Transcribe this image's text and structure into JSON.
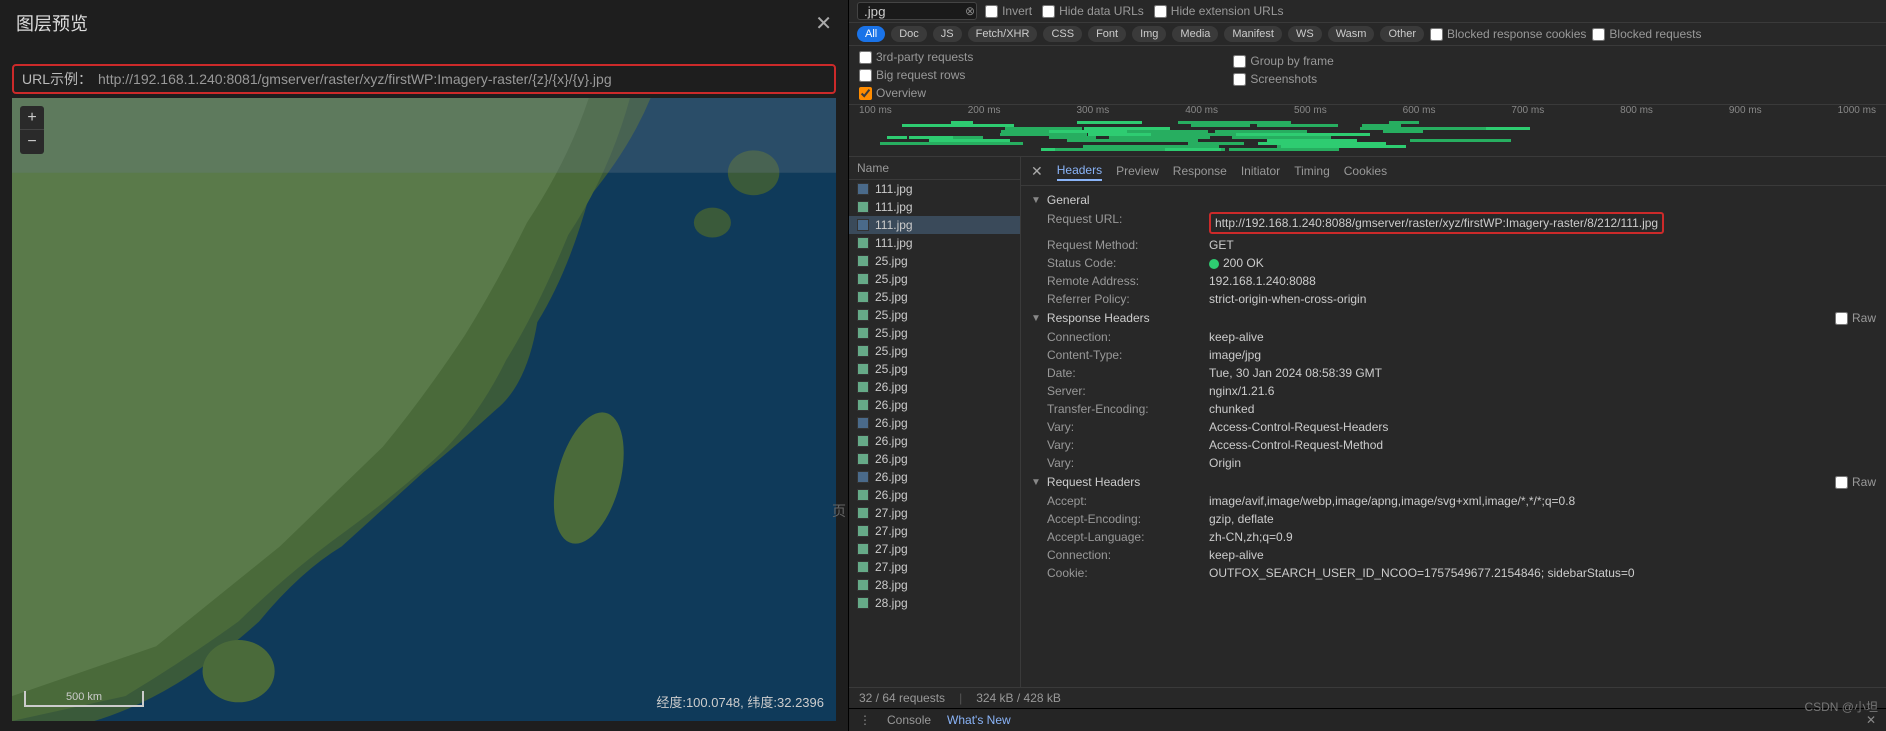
{
  "left": {
    "title": "图层预览",
    "url_label": "URL示例：",
    "url_value": "http://192.168.1.240:8081/gmserver/raster/xyz/firstWP:Imagery-raster/{z}/{x}/{y}.jpg",
    "scale": "500 km",
    "coords": "经度:100.0748, 纬度:32.2396",
    "page_glyph": "页",
    "watermark": "CSDN @小坦"
  },
  "devtools": {
    "filter_value": ".jpg",
    "checkboxes": {
      "invert": "Invert",
      "hide_data": "Hide data URLs",
      "hide_ext": "Hide extension URLs"
    },
    "types": [
      "All",
      "Doc",
      "JS",
      "Fetch/XHR",
      "CSS",
      "Font",
      "Img",
      "Media",
      "Manifest",
      "WS",
      "Wasm",
      "Other"
    ],
    "type_cb": {
      "blocked_cookies": "Blocked response cookies",
      "blocked_requests": "Blocked requests"
    },
    "opts": {
      "third_party": "3rd-party requests",
      "big_rows": "Big request rows",
      "overview": "Overview",
      "group_frame": "Group by frame",
      "screenshots": "Screenshots"
    },
    "timeline_ticks": [
      "100 ms",
      "200 ms",
      "300 ms",
      "400 ms",
      "500 ms",
      "600 ms",
      "700 ms",
      "800 ms",
      "900 ms",
      "1000 ms"
    ],
    "name_header": "Name",
    "requests": [
      {
        "name": "111.jpg",
        "sel": false,
        "c": "b"
      },
      {
        "name": "111.jpg",
        "sel": false,
        "c": "g"
      },
      {
        "name": "111.jpg",
        "sel": true,
        "c": "b"
      },
      {
        "name": "111.jpg",
        "sel": false,
        "c": "g"
      },
      {
        "name": "25.jpg",
        "sel": false,
        "c": "g"
      },
      {
        "name": "25.jpg",
        "sel": false,
        "c": "g"
      },
      {
        "name": "25.jpg",
        "sel": false,
        "c": "g"
      },
      {
        "name": "25.jpg",
        "sel": false,
        "c": "g"
      },
      {
        "name": "25.jpg",
        "sel": false,
        "c": "g"
      },
      {
        "name": "25.jpg",
        "sel": false,
        "c": "g"
      },
      {
        "name": "25.jpg",
        "sel": false,
        "c": "g"
      },
      {
        "name": "26.jpg",
        "sel": false,
        "c": "g"
      },
      {
        "name": "26.jpg",
        "sel": false,
        "c": "g"
      },
      {
        "name": "26.jpg",
        "sel": false,
        "c": "b"
      },
      {
        "name": "26.jpg",
        "sel": false,
        "c": "g"
      },
      {
        "name": "26.jpg",
        "sel": false,
        "c": "g"
      },
      {
        "name": "26.jpg",
        "sel": false,
        "c": "b"
      },
      {
        "name": "26.jpg",
        "sel": false,
        "c": "g"
      },
      {
        "name": "27.jpg",
        "sel": false,
        "c": "g"
      },
      {
        "name": "27.jpg",
        "sel": false,
        "c": "g"
      },
      {
        "name": "27.jpg",
        "sel": false,
        "c": "g"
      },
      {
        "name": "27.jpg",
        "sel": false,
        "c": "g"
      },
      {
        "name": "28.jpg",
        "sel": false,
        "c": "g"
      },
      {
        "name": "28.jpg",
        "sel": false,
        "c": "g"
      }
    ],
    "detail_tabs": [
      "Headers",
      "Preview",
      "Response",
      "Initiator",
      "Timing",
      "Cookies"
    ],
    "sections": {
      "general": "General",
      "response_headers": "Response Headers",
      "request_headers": "Request Headers",
      "raw": "Raw"
    },
    "general": {
      "Request URL:": "http://192.168.1.240:8088/gmserver/raster/xyz/firstWP:Imagery-raster/8/212/111.jpg",
      "Request Method:": "GET",
      "Status Code:": "200 OK",
      "Remote Address:": "192.168.1.240:8088",
      "Referrer Policy:": "strict-origin-when-cross-origin"
    },
    "response_headers": {
      "Connection:": "keep-alive",
      "Content-Type:": "image/jpg",
      "Date:": "Tue, 30 Jan 2024 08:58:39 GMT",
      "Server:": "nginx/1.21.6",
      "Transfer-Encoding:": "chunked",
      "Vary:": "Access-Control-Request-Headers",
      "Vary: ": "Access-Control-Request-Method",
      "Vary:  ": "Origin"
    },
    "request_headers": {
      "Accept:": "image/avif,image/webp,image/apng,image/svg+xml,image/*,*/*;q=0.8",
      "Accept-Encoding:": "gzip, deflate",
      "Accept-Language:": "zh-CN,zh;q=0.9",
      "Connection:": "keep-alive",
      "Cookie:": "OUTFOX_SEARCH_USER_ID_NCOO=1757549677.2154846; sidebarStatus=0"
    },
    "footer": {
      "req_count": "32 / 64 requests",
      "size": "324 kB / 428 kB"
    },
    "drawer": {
      "console": "Console",
      "whats_new": "What's New"
    }
  }
}
